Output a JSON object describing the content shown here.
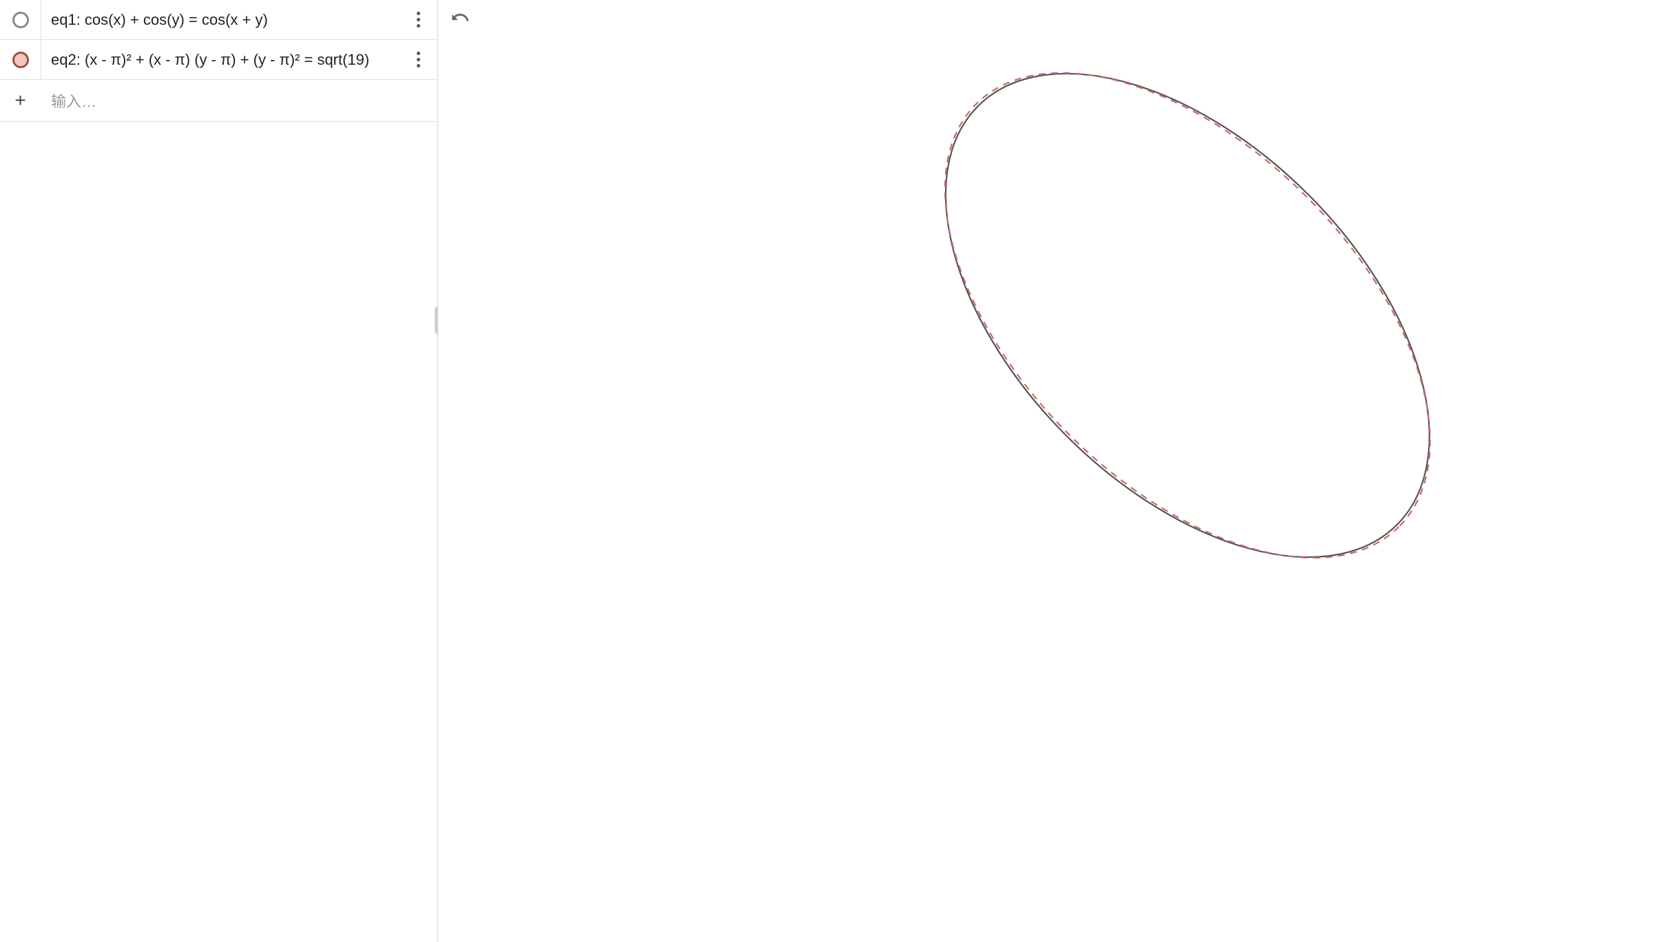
{
  "equations": [
    {
      "label": "eq1: cos(x) + cos(y) = cos(x + y)",
      "color": "#888888",
      "toggle_style": "gray",
      "visible": true
    },
    {
      "label": "eq2: (x - π)² + (x - π) (y - π) + (y - π)² = sqrt(19)",
      "color": "#b55a54",
      "toggle_style": "red",
      "visible": true
    }
  ],
  "input": {
    "placeholder": "输入…"
  },
  "icons": {
    "undo": "undo",
    "more": "more-vert",
    "add": "+"
  },
  "chart_data": {
    "type": "implicit-curve",
    "description": "Two overlapping rotated-ellipse-like implicit curves centered near (π, π). eq2 is an exact rotated ellipse (x-π)²+(x-π)(y-π)+(y-π)²=√19; eq1 cos(x)+cos(y)=cos(x+y) closely coincides with it in the displayed viewport.",
    "curves": [
      {
        "id": "eq1",
        "equation": "cos(x)+cos(y)=cos(x+y)",
        "stroke": "#555555",
        "style": "solid"
      },
      {
        "id": "eq2",
        "equation": "(x-π)^2+(x-π)(y-π)+(y-π)^2=sqrt(19)",
        "stroke": "#c96a62",
        "style": "dashed"
      }
    ],
    "center": {
      "x": 3.1416,
      "y": 3.1416
    },
    "ellipse_params_eq2": {
      "rhs": 4.3589,
      "semi_major": 2.951,
      "semi_minor": 1.704,
      "rotation_deg": -45
    },
    "viewport": {
      "xrange": [
        0.5,
        6.0
      ],
      "yrange": [
        0.2,
        6.0
      ]
    },
    "axes_visible": false,
    "grid_visible": false
  }
}
